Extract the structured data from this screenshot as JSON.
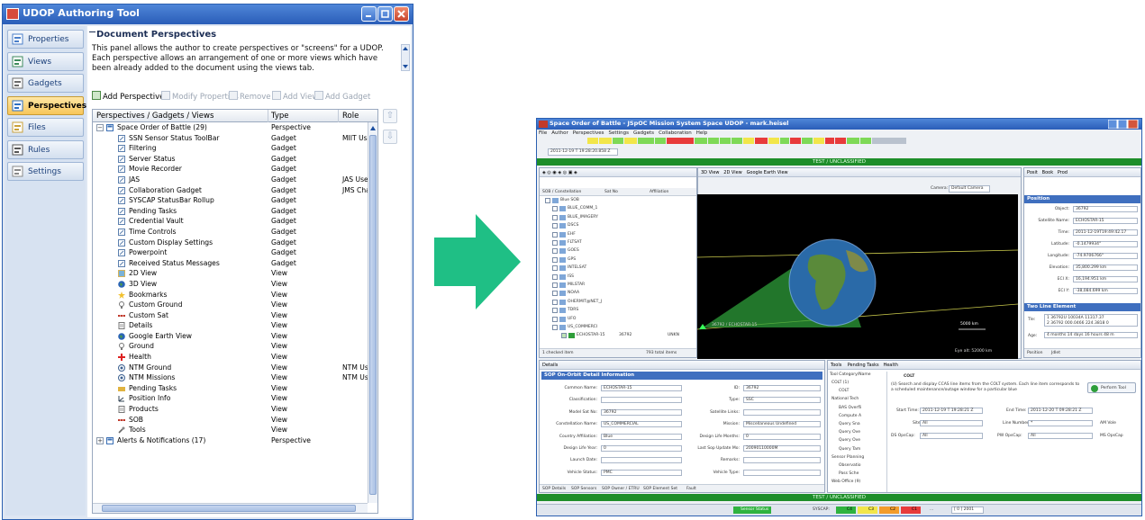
{
  "window": {
    "title": "UDOP Authoring Tool"
  },
  "nav": {
    "items": [
      {
        "label": "Properties",
        "icon": "properties-icon"
      },
      {
        "label": "Views",
        "icon": "views-icon"
      },
      {
        "label": "Gadgets",
        "icon": "gadgets-icon"
      },
      {
        "label": "Perspectives",
        "icon": "perspectives-icon",
        "active": true
      },
      {
        "label": "Files",
        "icon": "files-icon"
      },
      {
        "label": "Rules",
        "icon": "rules-icon"
      },
      {
        "label": "Settings",
        "icon": "settings-icon"
      }
    ]
  },
  "section": {
    "title": "Document Perspectives",
    "description": "This panel allows the author to create perspectives or \"screens\" for a UDOP. Each perspective allows an arrangement of one or more views which have been already added to the document using the views tab."
  },
  "toolbar": {
    "add_perspective": "Add Perspective",
    "modify_properties": "Modify Properties",
    "remove": "Remove",
    "add_view": "Add View",
    "add_gadget": "Add Gadget"
  },
  "table": {
    "columns": [
      "Perspectives / Gadgets / Views",
      "Type",
      "Role"
    ],
    "rows": [
      {
        "name": "Space Order of Battle (29)",
        "type": "Perspective",
        "role": "",
        "level": 0,
        "expander": "⊟",
        "icon": "perspective"
      },
      {
        "name": "SSN Sensor Status ToolBar",
        "type": "Gadget",
        "role": "MIIT User",
        "level": 1,
        "icon": "gadget"
      },
      {
        "name": "Filtering",
        "type": "Gadget",
        "role": "",
        "level": 1,
        "icon": "gadget"
      },
      {
        "name": "Server Status",
        "type": "Gadget",
        "role": "",
        "level": 1,
        "icon": "gadget"
      },
      {
        "name": "Movie Recorder",
        "type": "Gadget",
        "role": "",
        "level": 1,
        "icon": "gadget"
      },
      {
        "name": "JAS",
        "type": "Gadget",
        "role": "JAS User",
        "level": 1,
        "icon": "gadget"
      },
      {
        "name": "Collaboration Gadget",
        "type": "Gadget",
        "role": "JMS Chat",
        "level": 1,
        "icon": "gadget"
      },
      {
        "name": "SYSCAP StatusBar Rollup",
        "type": "Gadget",
        "role": "",
        "level": 1,
        "icon": "gadget"
      },
      {
        "name": "Pending Tasks",
        "type": "Gadget",
        "role": "",
        "level": 1,
        "icon": "gadget"
      },
      {
        "name": "Credential Vault",
        "type": "Gadget",
        "role": "",
        "level": 1,
        "icon": "gadget"
      },
      {
        "name": "Time Controls",
        "type": "Gadget",
        "role": "",
        "level": 1,
        "icon": "gadget"
      },
      {
        "name": "Custom Display Settings",
        "type": "Gadget",
        "role": "",
        "level": 1,
        "icon": "gadget"
      },
      {
        "name": "Powerpoint",
        "type": "Gadget",
        "role": "",
        "level": 1,
        "icon": "gadget"
      },
      {
        "name": "Received Status Messages",
        "type": "Gadget",
        "role": "",
        "level": 1,
        "icon": "gadget"
      },
      {
        "name": "2D View",
        "type": "View",
        "role": "",
        "level": 1,
        "icon": "map2d"
      },
      {
        "name": "3D View",
        "type": "View",
        "role": "",
        "level": 1,
        "icon": "globe"
      },
      {
        "name": "Bookmarks",
        "type": "View",
        "role": "",
        "level": 1,
        "icon": "star"
      },
      {
        "name": "Custom Ground",
        "type": "View",
        "role": "",
        "level": 1,
        "icon": "ground"
      },
      {
        "name": "Custom Sat",
        "type": "View",
        "role": "",
        "level": 1,
        "icon": "sat"
      },
      {
        "name": "Details",
        "type": "View",
        "role": "",
        "level": 1,
        "icon": "doc"
      },
      {
        "name": "Google Earth View",
        "type": "View",
        "role": "",
        "level": 1,
        "icon": "globe"
      },
      {
        "name": "Ground",
        "type": "View",
        "role": "",
        "level": 1,
        "icon": "ground"
      },
      {
        "name": "Health",
        "type": "View",
        "role": "",
        "level": 1,
        "icon": "health"
      },
      {
        "name": "NTM Ground",
        "type": "View",
        "role": "NTM User",
        "level": 1,
        "icon": "radar"
      },
      {
        "name": "NTM Missions",
        "type": "View",
        "role": "NTM User",
        "level": 1,
        "icon": "radar"
      },
      {
        "name": "Pending Tasks",
        "type": "View",
        "role": "",
        "level": 1,
        "icon": "tasks"
      },
      {
        "name": "Position Info",
        "type": "View",
        "role": "",
        "level": 1,
        "icon": "xyz"
      },
      {
        "name": "Products",
        "type": "View",
        "role": "",
        "level": 1,
        "icon": "doc"
      },
      {
        "name": "SOB",
        "type": "View",
        "role": "",
        "level": 1,
        "icon": "sat"
      },
      {
        "name": "Tools",
        "type": "View",
        "role": "",
        "level": 1,
        "icon": "tools"
      },
      {
        "name": "Alerts & Notifications (17)",
        "type": "Perspective",
        "role": "",
        "level": 0,
        "expander": "⊞",
        "icon": "perspective"
      }
    ]
  },
  "right_window": {
    "title": "Space Order of Battle - JSpOC Mission System Space UDOP - mark.heisel",
    "menu": [
      "File",
      "Author",
      "Perspectives",
      "Settings",
      "Gadgets",
      "Collaboration",
      "Help"
    ],
    "banner_top": "TEST / UNCLASSIFIED",
    "banner_bottom": "TEST / UNCLASSIFIED",
    "time": "2011-12-19 T 19:28:20.858 Z",
    "left_pane": {
      "columns": [
        "SOB / Constellation",
        "Sat No",
        "Affiliation"
      ],
      "rows": [
        "Blue SOB",
        "BLUE_COMM_1",
        "BLUE_IMAGERY",
        "DSCS",
        "EHF",
        "FLTSAT",
        "GOES",
        "GPS",
        "INTELSAT",
        "ISS",
        "MILSTAR",
        "NOAA",
        "OHERMIT@NET_J",
        "TDRS",
        "UFO",
        "US_COMMERCI",
        "ECHOSTAR-15"
      ],
      "sat_no": "36792",
      "affiliation": "UNKN",
      "footer_left": "1 checked item",
      "footer_right": "793 total items"
    },
    "map": {
      "tabs": [
        "3D View",
        "2D View",
        "Google Earth View"
      ],
      "camera_label": "Camera:",
      "camera_value": "Default Camera",
      "sat_label": "36792 / ECHOSTAR-15",
      "scale": "5000 km",
      "eye_alt": "Eye alt: 52000 km"
    },
    "position": {
      "tabs": [
        "Posit",
        "Book",
        "Prod"
      ],
      "header": "Position",
      "fields": [
        {
          "label": "Object:",
          "value": "36792"
        },
        {
          "label": "Satellite Name:",
          "value": "ECHOSTAR-15"
        },
        {
          "label": "Time:",
          "value": "2011-12-19T19:49:42.17"
        },
        {
          "label": "Latitude:",
          "value": "-0.1479934°"
        },
        {
          "label": "Longitude:",
          "value": "-74.9706766°"
        },
        {
          "label": "Elevation:",
          "value": "35,800.299 km"
        },
        {
          "label": "ECI X:",
          "value": "16,194.951 km"
        },
        {
          "label": "ECI Y:",
          "value": "-38,084.699 km"
        }
      ],
      "tle_header": "Two Line Element",
      "tle_label": "Tle:",
      "tle_lines": [
        "1 36792U 10034A 11317.37",
        "2 36792 000.0466 224.3818 0"
      ],
      "age_label": "Age:",
      "age_value": "4 months 14 days 16 hours 48 m",
      "bottom_tabs": [
        "Position",
        "Jdlet"
      ]
    },
    "details": {
      "tab": "Details",
      "header": "SOP On-Orbit Detail Information",
      "left_fields": [
        {
          "label": "Common Name:",
          "value": "ECHOSTAR-15"
        },
        {
          "label": "Classification:",
          "value": ""
        },
        {
          "label": "Model Sat No:",
          "value": "36792"
        },
        {
          "label": "Constellation Name:",
          "value": "US_COMMERCIAL"
        },
        {
          "label": "Country Affiliation:",
          "value": "Blue"
        },
        {
          "label": "Design Life Year:",
          "value": "0"
        },
        {
          "label": "Launch Date:",
          "value": ""
        },
        {
          "label": "Vehicle Status:",
          "value": "PMC"
        }
      ],
      "right_fields": [
        {
          "label": "ID:",
          "value": "36792"
        },
        {
          "label": "Type:",
          "value": "SSC"
        },
        {
          "label": "Satellite Links:",
          "value": ""
        },
        {
          "label": "Mission:",
          "value": "Miscellaneous Undefined"
        },
        {
          "label": "Design Life Months:",
          "value": "0"
        },
        {
          "label": "Last Sop Update Mo:",
          "value": "20090110000M"
        },
        {
          "label": "Remarks:",
          "value": ""
        },
        {
          "label": "Vehicle Type:",
          "value": ""
        }
      ],
      "bottom_tabs": [
        "SOP Details",
        "SOP Sensors",
        "SOP Owner / ETRU",
        "SOP Element Set",
        "Fault"
      ]
    },
    "tools": {
      "tabs": [
        "Tools",
        "Pending Tasks",
        "Health"
      ],
      "tree_header": "Tool Category/Name",
      "tree": [
        "COLT (1)",
        "COLT",
        "National Tech",
        "BAS Overfli",
        "Compute A",
        "Query Sna",
        "Query Ove",
        "Query Ove",
        "Query Tam",
        "Sensor Planning",
        "Observatio",
        "Pass Sche",
        "Web Office (9)"
      ],
      "tool_name": "COLT",
      "tool_desc": "(U) Search and display CCAS line items from the COLT system. Each line item corresponds to a scheduled maintenance/outage window for a particular blue",
      "perform_label": "Perform Tool",
      "start_label": "Start Time:",
      "start_value": "2011-12-19 T 19:28:21 Z",
      "end_label": "End Time:",
      "end_value": "2011-12-20 T 09:28:21 Z",
      "site_label": "Site:",
      "site_value": "All",
      "line_label": "Line Number:",
      "line_value": "*",
      "ds_label": "DS OpsCap:",
      "ds_value": "All",
      "pw_label": "PW OpsCap:",
      "pw_value": "All",
      "am_label": "AM Vole",
      "ms_label": "MS OpsCap"
    },
    "status": {
      "sensor_status": "Sensor Status",
      "syscap": "SYSCAP:",
      "dots": "...",
      "zoom": "[ 0 ] 2001",
      "counts": [
        "C4",
        "C3",
        "C2",
        "C1"
      ]
    }
  },
  "colors": {
    "accent": "#2a5db8",
    "active_nav": "#f7c65a",
    "arrow": "#1fbf85",
    "banner": "#1e8e2a"
  }
}
